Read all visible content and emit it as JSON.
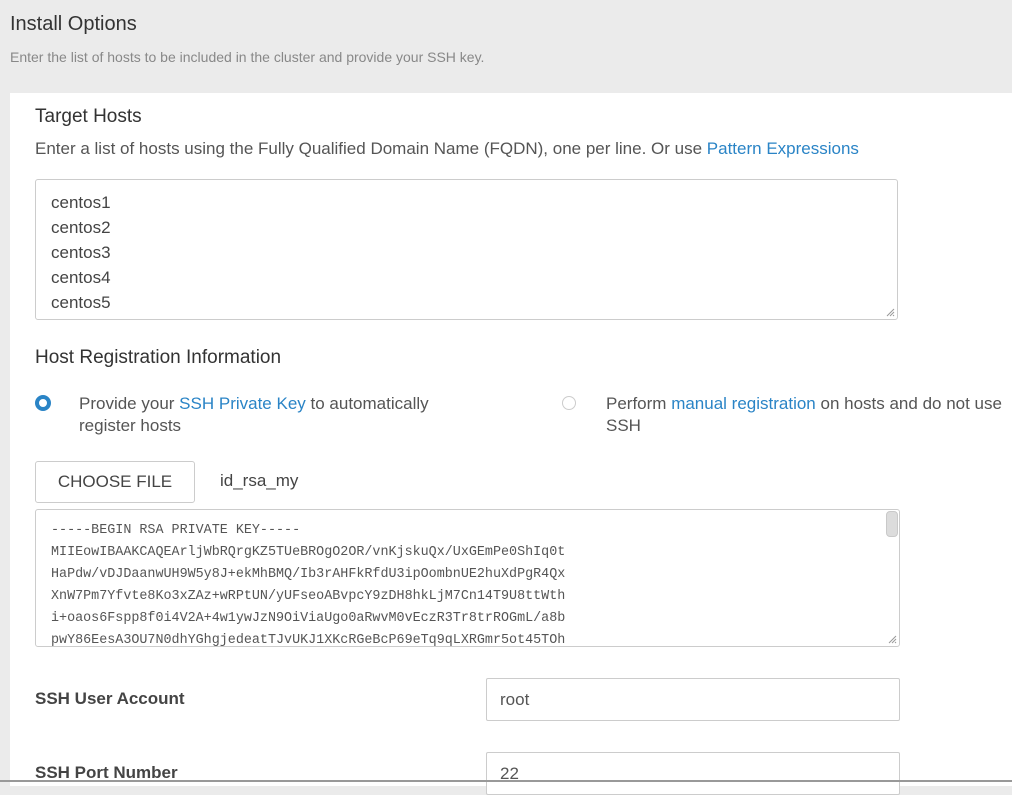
{
  "header": {
    "title": "Install Options",
    "subtitle": "Enter the list of hosts to be included in the cluster and provide your SSH key."
  },
  "target_hosts": {
    "title": "Target Hosts",
    "description": "Enter a list of hosts using the Fully Qualified Domain Name (FQDN), one per line. Or use ",
    "link": "Pattern Expressions",
    "hosts": [
      "centos1",
      "centos2",
      "centos3",
      "centos4",
      "centos5"
    ]
  },
  "registration": {
    "title": "Host Registration Information",
    "option_ssh": {
      "prefix": "Provide your ",
      "link": "SSH Private Key",
      "suffix": " to automatically register hosts",
      "selected": true
    },
    "option_manual": {
      "prefix": "Perform ",
      "link": "manual registration",
      "suffix": " on hosts and do not use SSH",
      "selected": false
    },
    "choose_file_label": "CHOOSE FILE",
    "file_name": "id_rsa_my",
    "private_key": "-----BEGIN RSA PRIVATE KEY-----\nMIIEowIBAAKCAQEArljWbRQrgKZ5TUeBROgO2OR/vnKjskuQx/UxGEmPe0ShIq0t\nHaPdw/vDJDaanwUH9W5y8J+ekMhBMQ/Ib3rAHFkRfdU3ipOombnUE2huXdPgR4Qx\nXnW7Pm7Yfvte8Ko3xZAz+wRPtUN/yUFseoABvpcY9zDH8hkLjM7Cn14T9U8ttWth\ni+oaos6Fspp8f0i4V2A+4w1ywJzN9OiViaUgo0aRwvM0vEczR3Tr8trROGmL/a8b\npwY86EesA3OU7N0dhYGhgjedeatTJvUKJ1XKcRGeBcP69eTq9qLXRGmr5ot45TOh"
  },
  "ssh_user": {
    "label": "SSH User Account",
    "value": "root"
  },
  "ssh_port": {
    "label": "SSH Port Number",
    "value": "22"
  },
  "colors": {
    "accent": "#2a84c6",
    "header_bg": "#ebebeb"
  }
}
